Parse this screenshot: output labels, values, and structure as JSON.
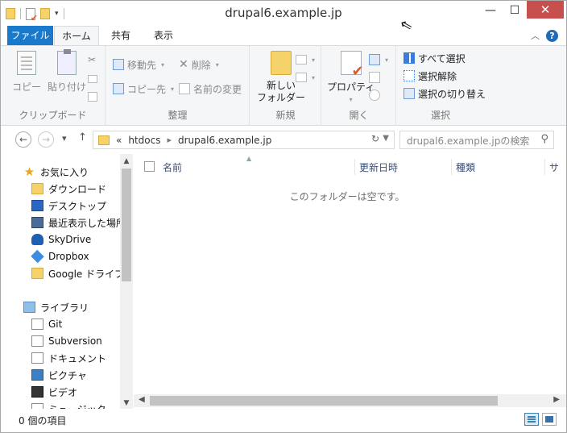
{
  "window": {
    "title": "drupal6.example.jp",
    "min_glyph": "—",
    "max_glyph": "☐",
    "close_glyph": "✕"
  },
  "ribbon_tabs": {
    "file": "ファイル",
    "home": "ホーム",
    "share": "共有",
    "view": "表示"
  },
  "ribbon": {
    "clipboard": {
      "label": "クリップボード",
      "copy": "コピー",
      "paste": "貼り付け"
    },
    "organize": {
      "label": "整理",
      "move_to": "移動先",
      "copy_to": "コピー先",
      "delete": "削除",
      "rename": "名前の変更"
    },
    "new": {
      "label": "新規",
      "new_folder_line1": "新しい",
      "new_folder_line2": "フォルダー"
    },
    "open": {
      "label": "開く",
      "properties": "プロパティ"
    },
    "select": {
      "label": "選択",
      "select_all": "すべて選択",
      "select_none": "選択解除",
      "invert": "選択の切り替え"
    }
  },
  "address": {
    "overflow": "«",
    "crumbs": [
      "htdocs",
      "drupal6.example.jp"
    ],
    "search_placeholder": "drupal6.example.jpの検索"
  },
  "nav_pane": {
    "favorites": "お気に入り",
    "favorites_items": [
      "ダウンロード",
      "デスクトップ",
      "最近表示した場所",
      "SkyDrive",
      "Dropbox",
      "Google ドライブ"
    ],
    "libraries": "ライブラリ",
    "library_items": [
      "Git",
      "Subversion",
      "ドキュメント",
      "ピクチャ",
      "ビデオ",
      "ミュージック"
    ]
  },
  "columns": {
    "name": "名前",
    "modified": "更新日時",
    "type": "種類",
    "size": "サ"
  },
  "content": {
    "empty_message": "このフォルダーは空です。"
  },
  "status": {
    "item_count": "0 個の項目"
  }
}
